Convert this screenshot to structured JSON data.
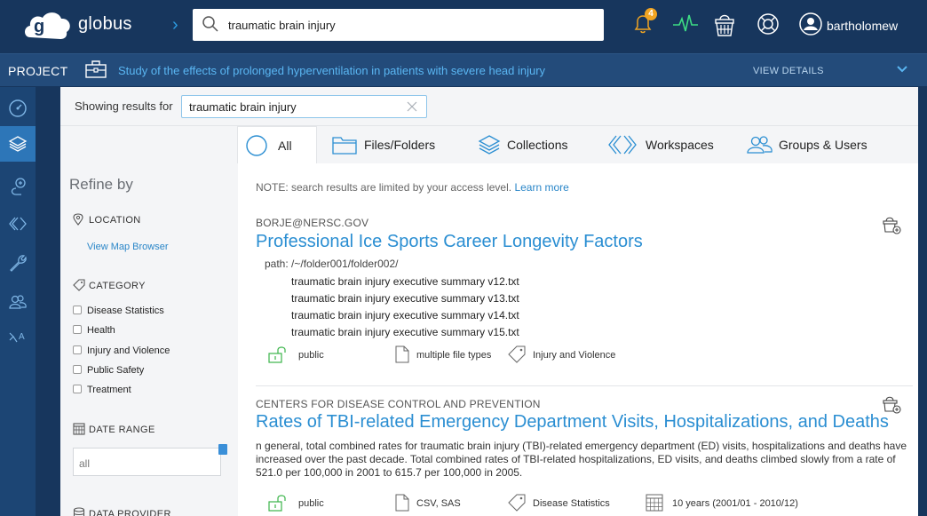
{
  "brand": {
    "name": "globus"
  },
  "search": {
    "query": "traumatic brain injury"
  },
  "notifications": {
    "count": "4"
  },
  "user": {
    "name": "bartholomew"
  },
  "project": {
    "label": "PROJECT",
    "title": "Study of the effects of prolonged hyperventilation in patients with severe head injury",
    "view_details": "VIEW DETAILS"
  },
  "sidebar": {
    "items": [
      {
        "icon": "dashboard-icon"
      },
      {
        "icon": "layers-icon"
      },
      {
        "icon": "transfer-icon"
      },
      {
        "icon": "workspaces-icon"
      },
      {
        "icon": "wrench-icon"
      },
      {
        "icon": "groups-icon"
      },
      {
        "icon": "translate-icon"
      }
    ]
  },
  "showing": {
    "label": "Showing results for",
    "query": "traumatic brain injury"
  },
  "tabs": [
    {
      "label": "All"
    },
    {
      "label": "Files/Folders"
    },
    {
      "label": "Collections"
    },
    {
      "label": "Workspaces"
    },
    {
      "label": "Groups & Users"
    }
  ],
  "refine": {
    "title": "Refine by",
    "location_head": "LOCATION",
    "map_link": "View Map Browser",
    "category_head": "CATEGORY",
    "categories": [
      "Disease Statistics",
      "Health",
      "Injury and Violence",
      "Public Safety",
      "Treatment"
    ],
    "date_head": "DATE RANGE",
    "date_value": "all",
    "provider_head": "DATA PROVIDER"
  },
  "results": {
    "note_text": "NOTE: search results are limited by your access level.",
    "note_link": "Learn more",
    "items": [
      {
        "source": "BORJE@NERSC.GOV",
        "title": "Professional Ice Sports Career Longevity Factors",
        "path": "path: /~/folder001/folder002/",
        "files": [
          "traumatic brain injury executive summary v12.txt",
          "traumatic brain injury executive summary v13.txt",
          "traumatic brain injury executive summary v14.txt",
          "traumatic brain injury executive summary v15.txt"
        ],
        "access": "public",
        "types": "multiple file types",
        "category": "Injury and Violence"
      },
      {
        "source": "CENTERS FOR DISEASE CONTROL AND PREVENTION",
        "title": "Rates of TBI-related Emergency Department Visits, Hospitalizations, and Deaths",
        "description": "n general, total combined rates for traumatic brain injury (TBI)-related emergency department (ED) visits, hospitalizations and deaths have increased over the past decade. Total combined rates of TBI-related hospitalizations, ED visits, and deaths climbed slowly from a rate of 521.0 per 100,000 in 2001 to 615.7 per 100,000 in 2005.",
        "access": "public",
        "types": "CSV, SAS",
        "category": "Disease Statistics",
        "date_range": "10 years (2001/01 - 2010/12)"
      }
    ]
  },
  "colors": {
    "accent": "#2a8ed2",
    "topbar": "#17365d",
    "projbar": "#234b7a",
    "badge": "#f0a422",
    "pulse": "#3ddc84"
  }
}
